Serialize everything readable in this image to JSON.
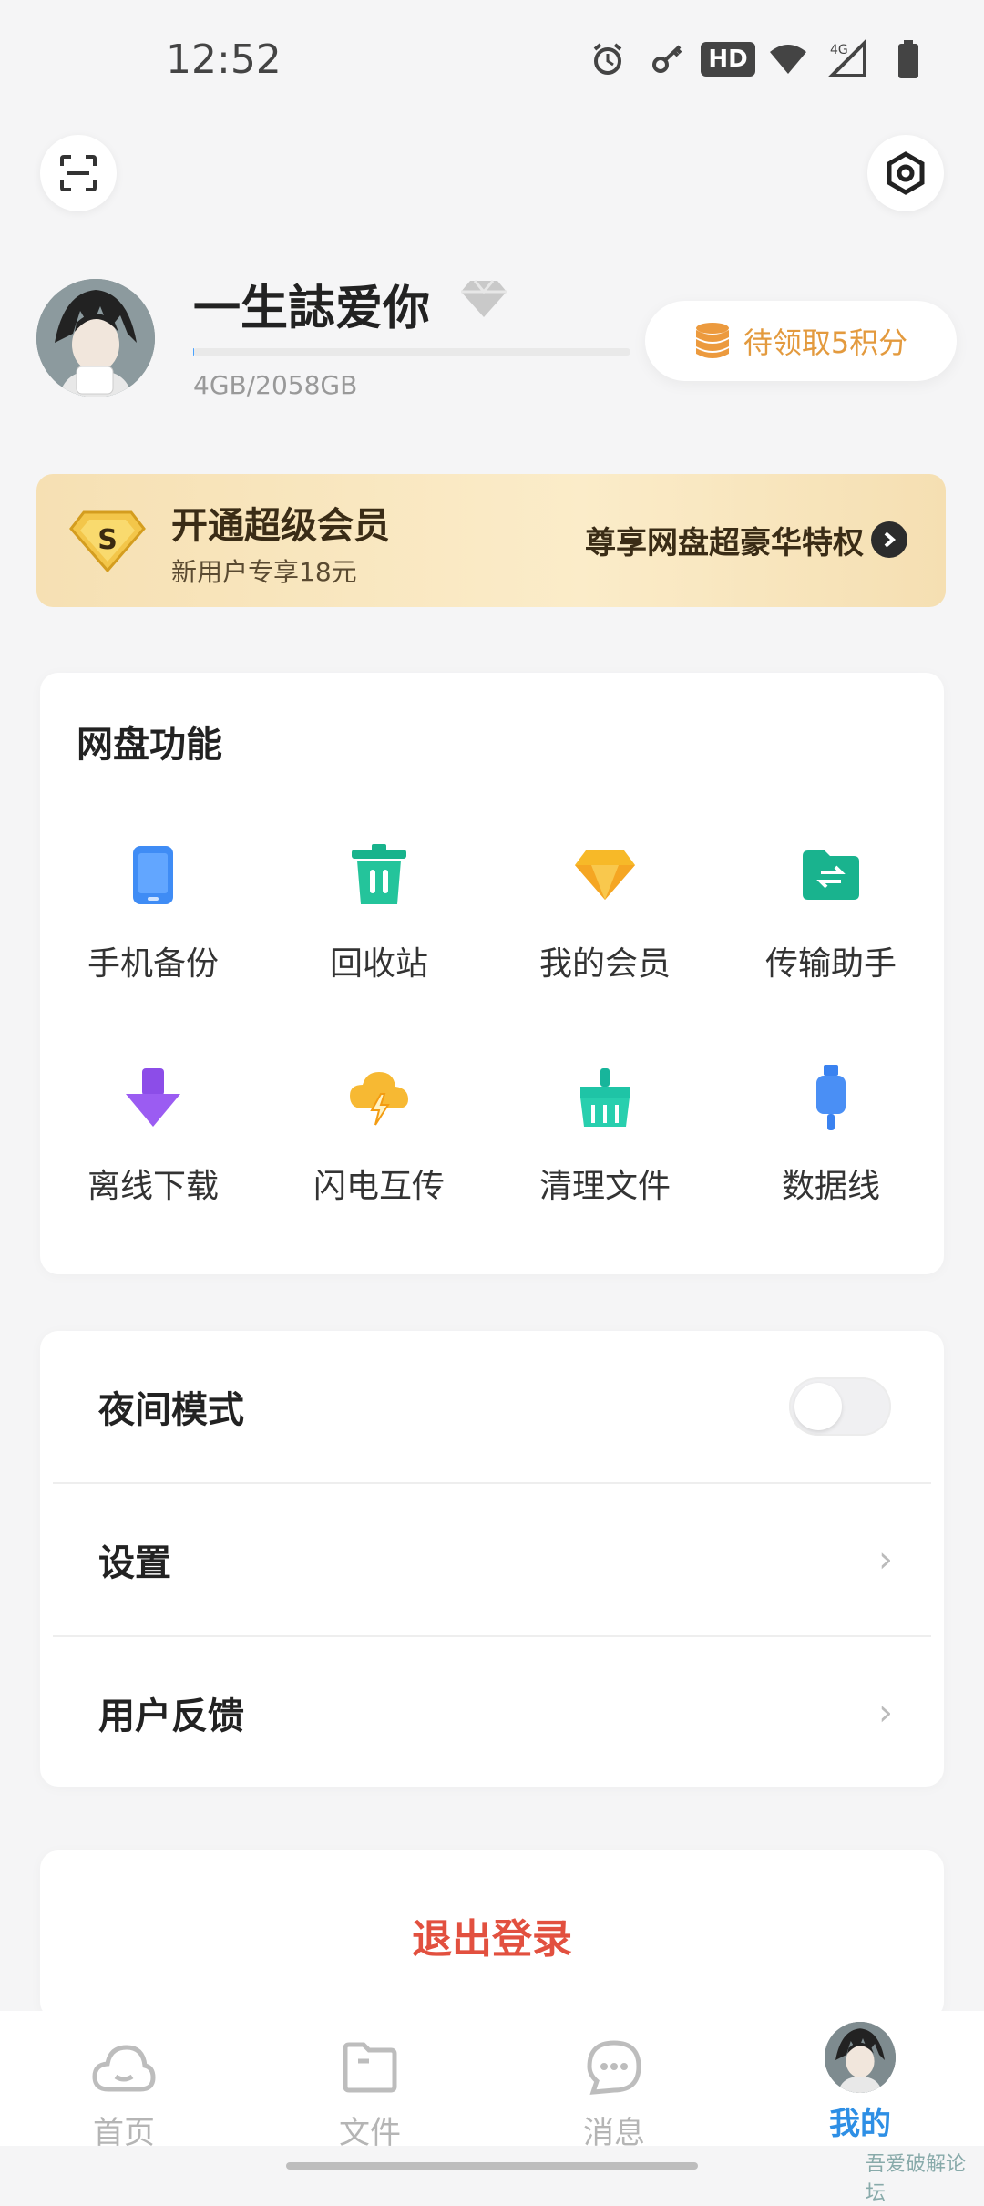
{
  "status_bar": {
    "time": "12:52",
    "icons": [
      "alarm-icon",
      "key-icon",
      "hd-icon",
      "wifi-icon",
      "4g-signal-icon",
      "battery-icon"
    ],
    "hd_label": "HD"
  },
  "top_actions": {
    "scan_icon": "scan-icon",
    "settings_icon": "gear-icon"
  },
  "profile": {
    "username": "一生誌爱你",
    "storage": "4GB/2058GB",
    "storage_used_fraction": 0.002,
    "points_button": "待领取5积分"
  },
  "vip_banner": {
    "badge_letter": "S",
    "title": "开通超级会员",
    "subtitle": "新用户专享18元",
    "right_text": "尊享网盘超豪华特权"
  },
  "features": {
    "title": "网盘功能",
    "items": [
      {
        "label": "手机备份",
        "icon": "phone-backup-icon"
      },
      {
        "label": "回收站",
        "icon": "trash-icon"
      },
      {
        "label": "我的会员",
        "icon": "diamond-icon"
      },
      {
        "label": "传输助手",
        "icon": "transfer-folder-icon"
      },
      {
        "label": "离线下载",
        "icon": "download-arrow-icon"
      },
      {
        "label": "闪电互传",
        "icon": "lightning-cloud-icon"
      },
      {
        "label": "清理文件",
        "icon": "broom-icon"
      },
      {
        "label": "数据线",
        "icon": "usb-cable-icon"
      }
    ]
  },
  "settings": {
    "night_mode": "夜间模式",
    "night_mode_on": false,
    "settings": "设置",
    "feedback": "用户反馈"
  },
  "logout": "退出登录",
  "bottom_nav": {
    "home": "首页",
    "files": "文件",
    "messages": "消息",
    "mine": "我的"
  },
  "watermark": "吾爱破解论坛"
}
